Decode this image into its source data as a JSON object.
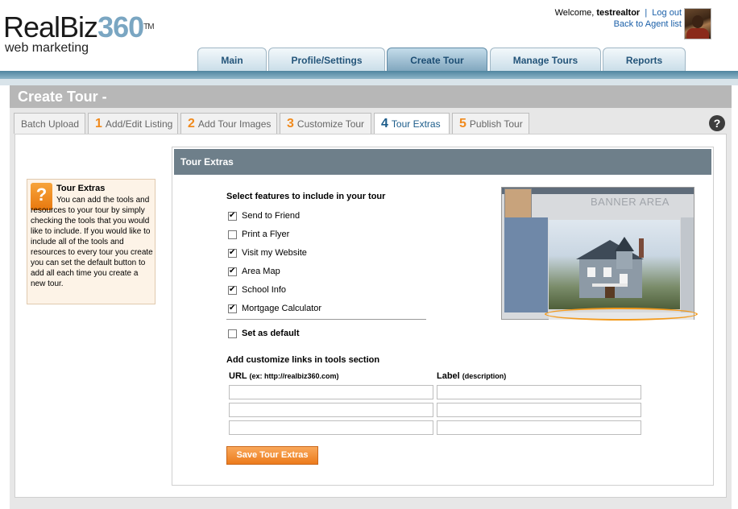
{
  "logo": {
    "brand": "RealBiz",
    "number": "360",
    "tm": "TM",
    "tagline": "web marketing"
  },
  "header": {
    "welcome_prefix": "Welcome,",
    "username": "testrealtor",
    "separator": "|",
    "logout": "Log out",
    "back_link": "Back to Agent list"
  },
  "main_tabs": [
    {
      "label": "Main"
    },
    {
      "label": "Profile/Settings"
    },
    {
      "label": "Create Tour",
      "active": true
    },
    {
      "label": "Manage Tours"
    },
    {
      "label": "Reports"
    }
  ],
  "page_title": "Create Tour -",
  "steps": [
    {
      "num": "",
      "label": "Batch Upload"
    },
    {
      "num": "1",
      "label": "Add/Edit Listing"
    },
    {
      "num": "2",
      "label": "Add Tour Images"
    },
    {
      "num": "3",
      "label": "Customize Tour"
    },
    {
      "num": "4",
      "label": "Tour Extras",
      "active": true
    },
    {
      "num": "5",
      "label": "Publish Tour"
    }
  ],
  "help_icon": {
    "glyph": "?",
    "icon": "question-icon"
  },
  "help_box": {
    "icon_glyph": "?",
    "title": "Tour Extras",
    "text": "You can add the tools and resources to your tour by simply checking the tools that you would like to include. If you would like to include all of the tools and resources to every tour you create you can set the default button to add all each time you create a new tour."
  },
  "extras": {
    "header": "Tour Extras",
    "select_title": "Select features to include in your tour",
    "features": [
      {
        "label": "Send to Friend",
        "checked": true
      },
      {
        "label": "Print a Flyer",
        "checked": false
      },
      {
        "label": "Visit my Website",
        "checked": true
      },
      {
        "label": "Area Map",
        "checked": true
      },
      {
        "label": "School Info",
        "checked": true
      },
      {
        "label": "Mortgage Calculator",
        "checked": true
      }
    ],
    "set_default": {
      "label": "Set as default",
      "checked": false
    },
    "links_title": "Add customize links in tools section",
    "url_header": "URL",
    "url_hint": "(ex: http://realbiz360.com)",
    "label_header": "Label",
    "label_hint": "(description)",
    "link_rows": [
      {
        "url": "",
        "label": ""
      },
      {
        "url": "",
        "label": ""
      },
      {
        "url": "",
        "label": ""
      }
    ],
    "save_button": "Save Tour Extras"
  },
  "preview": {
    "banner_text": "BANNER AREA"
  },
  "colors": {
    "accent_orange": "#ec7b1c",
    "tab_blue": "#24557a",
    "header_gray": "#6e7f8a"
  }
}
